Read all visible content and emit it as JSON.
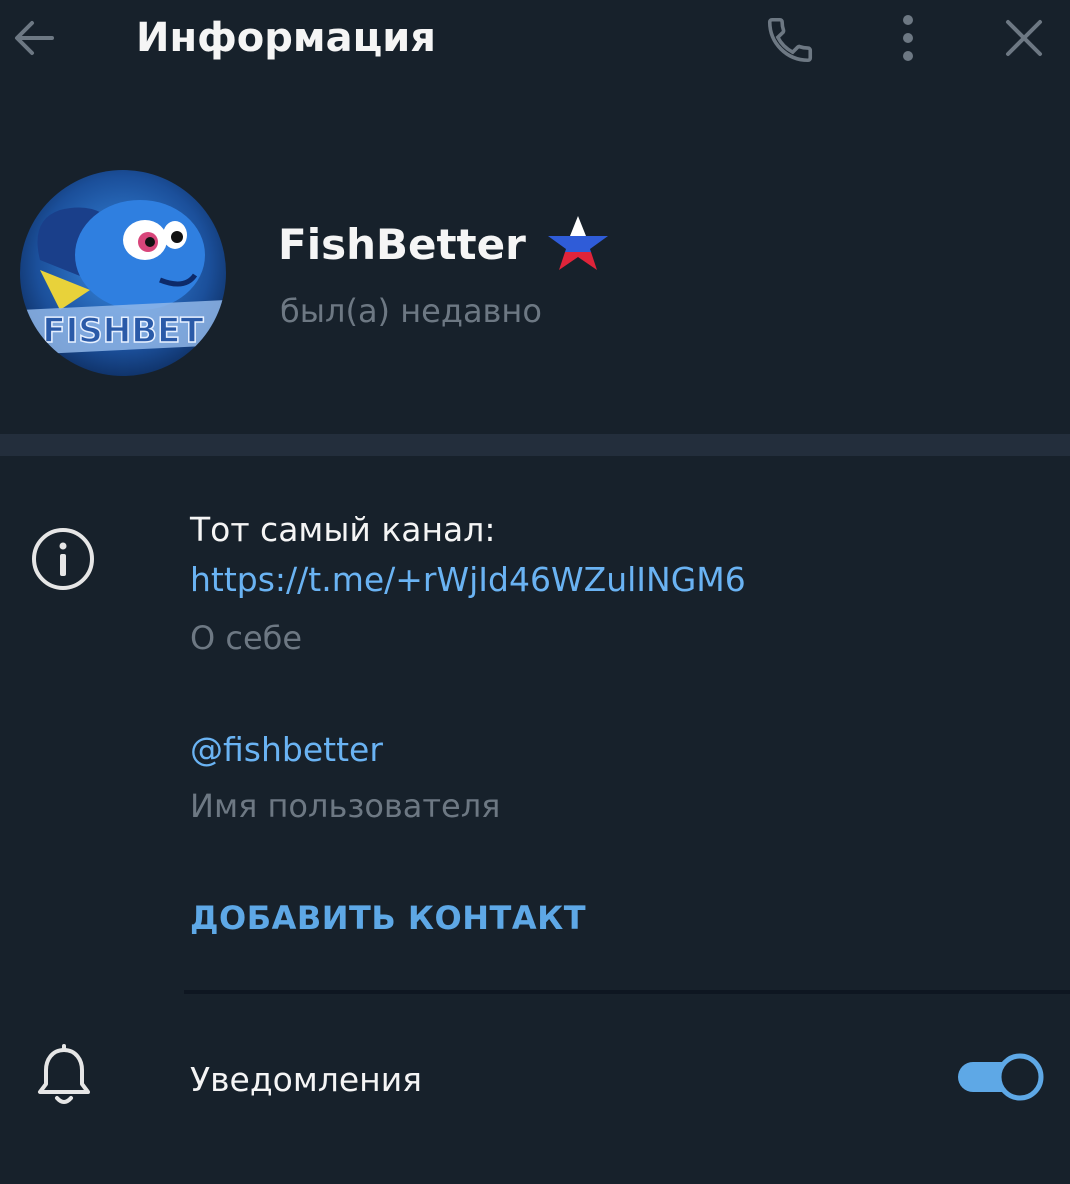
{
  "header": {
    "title": "Информация",
    "back_icon": "arrow-left-icon",
    "call_icon": "phone-icon",
    "more_icon": "more-vertical-icon",
    "close_icon": "close-icon"
  },
  "profile": {
    "name": "FishBetter",
    "status": "был(а) недавно",
    "avatar_text": "FISHBET",
    "badge_icon": "russian-flag-star-icon"
  },
  "info": {
    "bio_text": "Тот самый канал:",
    "bio_link": "https://t.me/+rWjId46WZulINGM6",
    "bio_caption": "О себе",
    "username": "@fishbetter",
    "username_caption": "Имя пользователя",
    "add_contact": "ДОБАВИТЬ КОНТАКТ"
  },
  "notifications": {
    "label": "Уведомления",
    "enabled": true
  },
  "colors": {
    "background": "#17212b",
    "accent": "#6ab3f3",
    "muted": "#6d7883",
    "separator": "#232e3c"
  }
}
